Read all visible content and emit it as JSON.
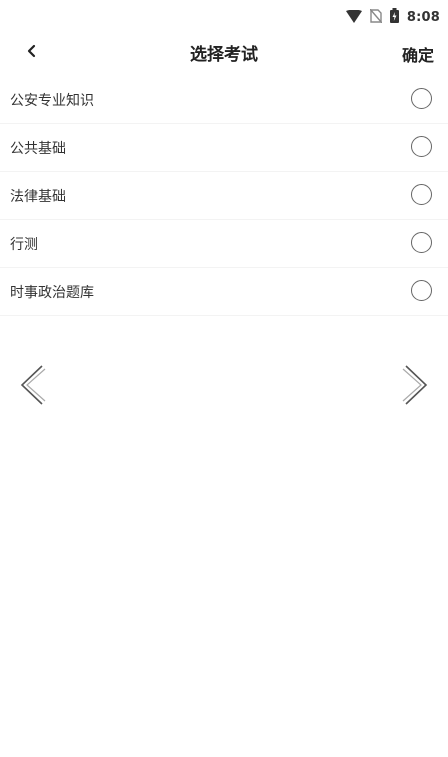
{
  "status_bar": {
    "time": "8:08",
    "icons": [
      "wifi-icon",
      "no-sim-icon",
      "battery-icon"
    ]
  },
  "header": {
    "back_icon": "chevron-left-icon",
    "title": "选择考试",
    "confirm_label": "确定"
  },
  "exams": [
    {
      "label": "公安专业知识",
      "selected": false
    },
    {
      "label": "公共基础",
      "selected": false
    },
    {
      "label": "法律基础",
      "selected": false
    },
    {
      "label": "行测",
      "selected": false
    },
    {
      "label": "时事政治题库",
      "selected": false
    }
  ],
  "pager": {
    "prev_icon": "double-chevron-left-icon",
    "next_icon": "double-chevron-right-icon"
  }
}
